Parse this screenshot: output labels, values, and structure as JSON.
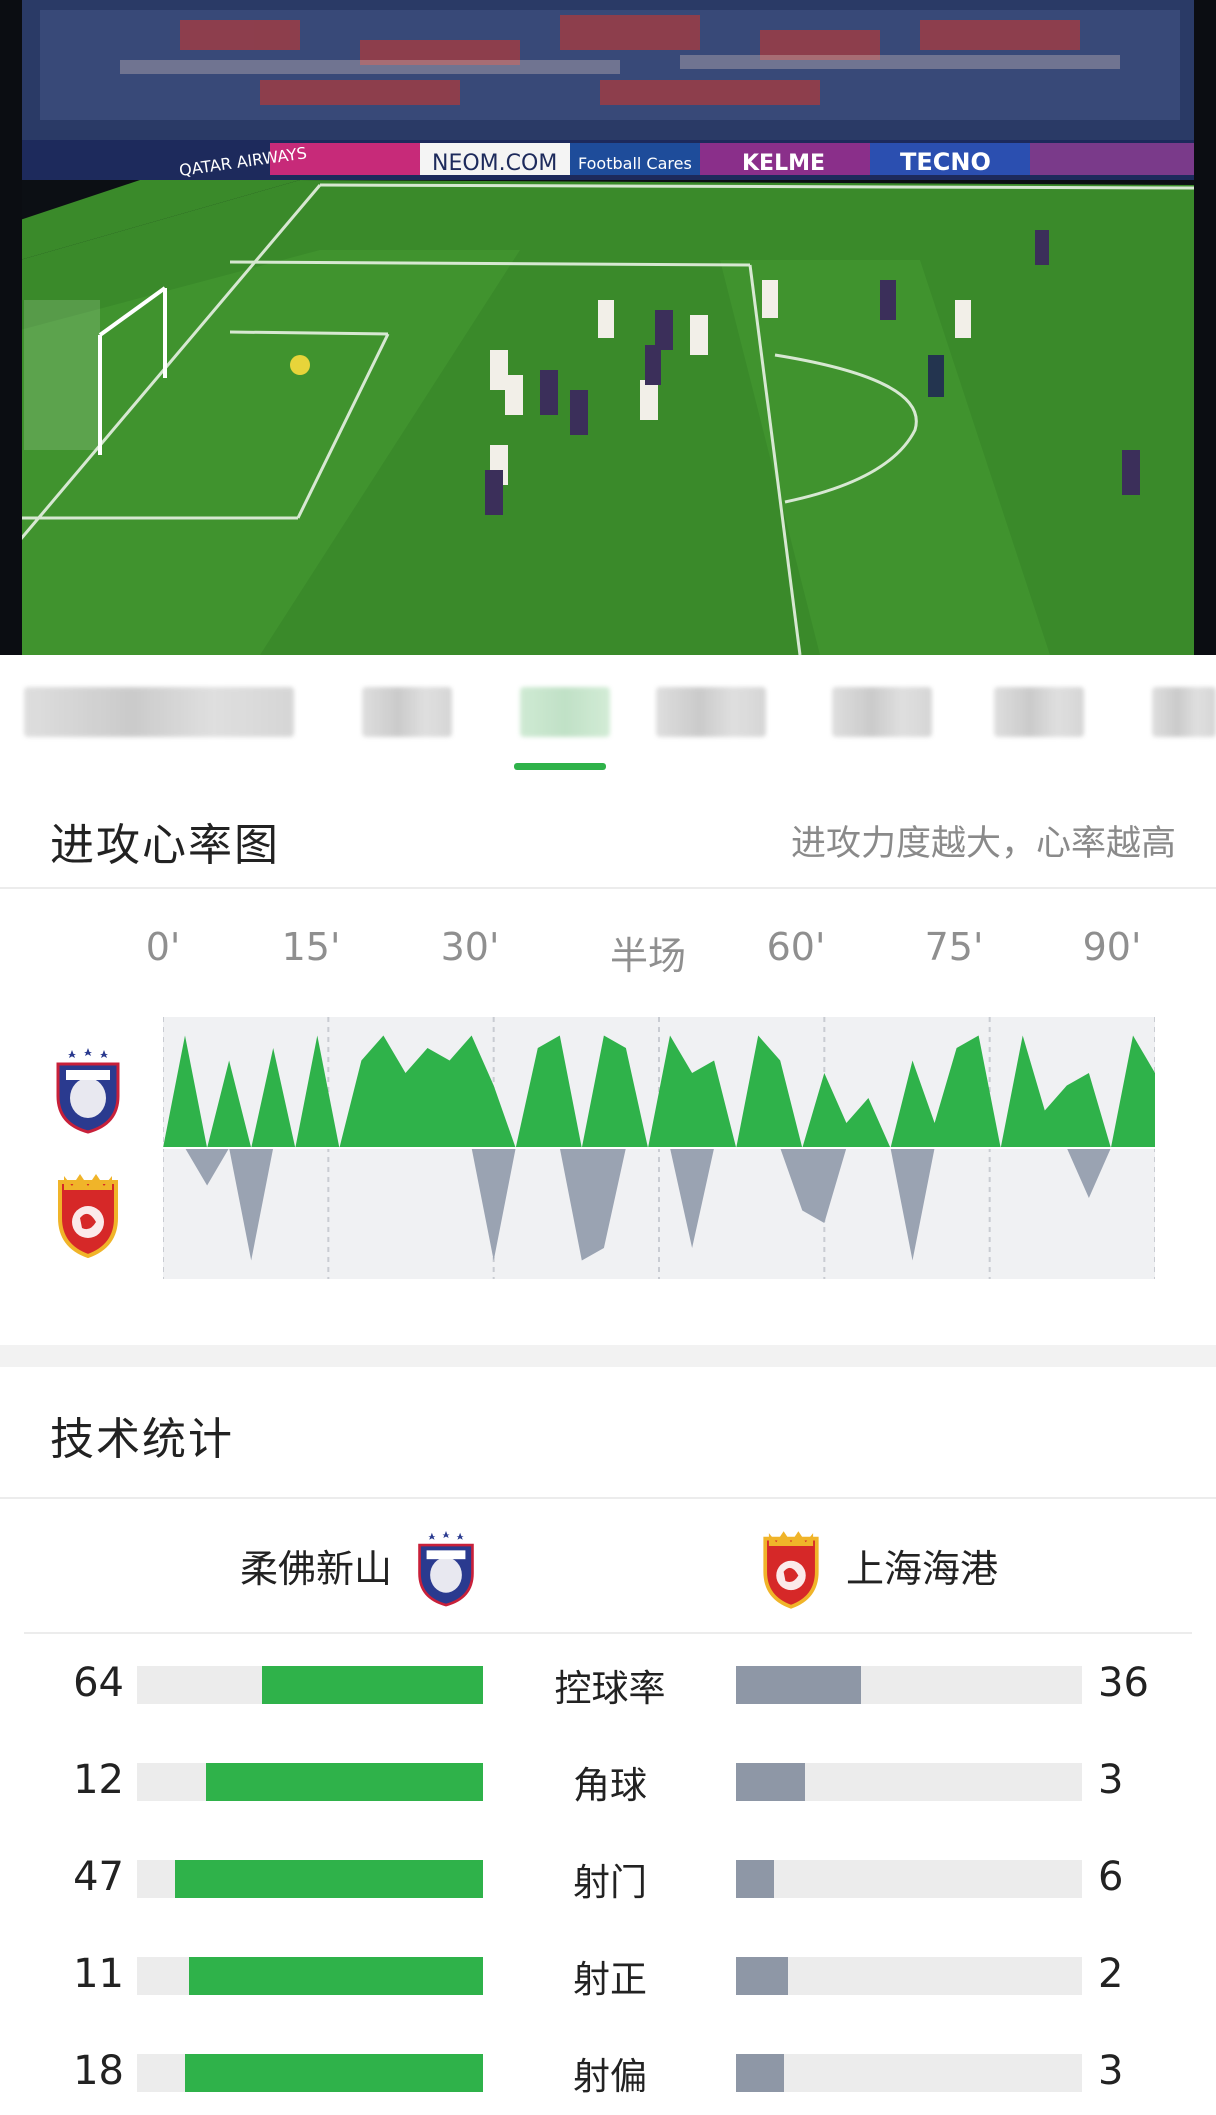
{
  "video": {
    "ads": [
      "QATAR AIRWAYS",
      "NEOM.COM",
      "Football Cares",
      "KELME",
      "TECNO"
    ]
  },
  "tabs": {
    "active_index": 3,
    "active_color": "#2fb24a"
  },
  "heart_rate": {
    "title": "进攻心率图",
    "note": "进攻力度越大，心率越高",
    "time_labels": [
      "0'",
      "15'",
      "30'",
      "半场",
      "60'",
      "75'",
      "90'"
    ]
  },
  "chart_data": {
    "type": "area",
    "title": "进攻心率图",
    "x_labels": [
      "0'",
      "15'",
      "30'",
      "半场",
      "60'",
      "75'",
      "90'"
    ],
    "x": [
      0,
      2,
      4,
      6,
      8,
      10,
      12,
      14,
      16,
      18,
      20,
      22,
      24,
      26,
      28,
      30,
      32,
      34,
      36,
      38,
      40,
      42,
      44,
      46,
      48,
      50,
      52,
      54,
      56,
      58,
      60,
      62,
      64,
      66,
      68,
      70,
      72,
      74,
      76,
      78,
      80,
      82,
      84,
      86,
      88,
      90
    ],
    "series": [
      {
        "color": "#2fb24a",
        "values": [
          0.0,
          0.9,
          0.0,
          0.7,
          0.0,
          0.8,
          0.0,
          0.9,
          0.0,
          0.7,
          0.9,
          0.6,
          0.8,
          0.7,
          0.9,
          0.5,
          0.0,
          0.8,
          0.9,
          0.0,
          0.9,
          0.8,
          0.0,
          0.9,
          0.6,
          0.7,
          0.0,
          0.9,
          0.7,
          0.0,
          0.6,
          0.2,
          0.4,
          0.0,
          0.7,
          0.2,
          0.8,
          0.9,
          0.0,
          0.9,
          0.3,
          0.5,
          0.6,
          0.0,
          0.9,
          0.6
        ]
      },
      {
        "color": "#9aa3b2",
        "values": [
          0.0,
          0.0,
          0.3,
          0.0,
          0.9,
          0.0,
          0.0,
          0.0,
          0.0,
          0.0,
          0.0,
          0.0,
          0.0,
          0.0,
          0.0,
          0.9,
          0.0,
          0.0,
          0.0,
          0.9,
          0.8,
          0.0,
          0.0,
          0.0,
          0.8,
          0.0,
          0.0,
          0.0,
          0.0,
          0.5,
          0.6,
          0.0,
          0.0,
          0.0,
          0.9,
          0.0,
          0.0,
          0.0,
          0.0,
          0.0,
          0.0,
          0.0,
          0.4,
          0.0,
          0.0,
          0.0
        ]
      }
    ],
    "grid": true
  },
  "stats": {
    "title": "技术统计",
    "home_team": "柔佛新山",
    "away_team": "上海海港",
    "home_color": "#2fb24a",
    "away_color": "#8e97a6",
    "rows": [
      {
        "label": "控球率",
        "home": "64",
        "away": "36",
        "home_ratio": 0.64,
        "away_ratio": 0.36
      },
      {
        "label": "角球",
        "home": "12",
        "away": "3",
        "home_ratio": 0.8,
        "away_ratio": 0.2
      },
      {
        "label": "射门",
        "home": "47",
        "away": "6",
        "home_ratio": 0.89,
        "away_ratio": 0.11
      },
      {
        "label": "射正",
        "home": "11",
        "away": "2",
        "home_ratio": 0.85,
        "away_ratio": 0.15
      },
      {
        "label": "射偏",
        "home": "18",
        "away": "3",
        "home_ratio": 0.86,
        "away_ratio": 0.14
      }
    ]
  }
}
